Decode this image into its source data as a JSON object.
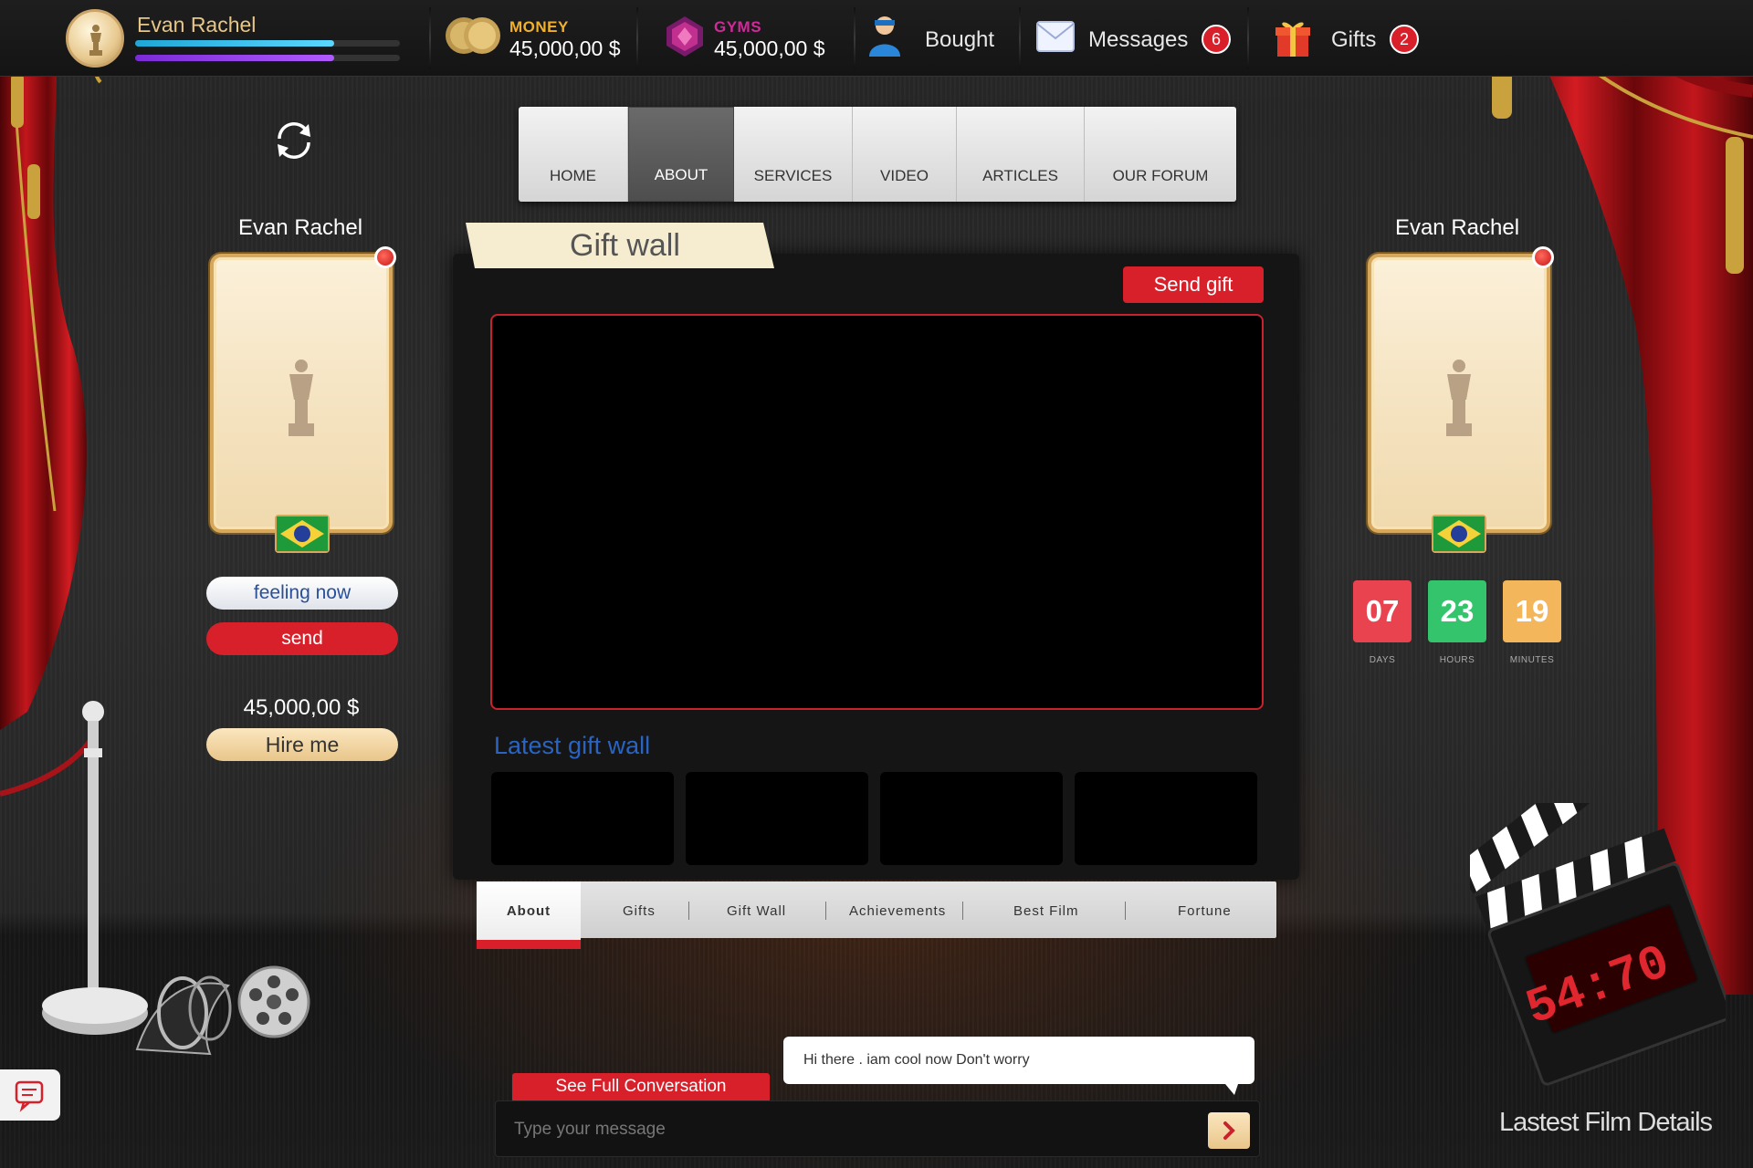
{
  "header": {
    "user_name": "Evan Rachel",
    "money_label": "MONEY",
    "money_value": "45,000,00 $",
    "gyms_label": "GYMS",
    "gyms_value": "45,000,00 $",
    "bought_label": "Bought",
    "messages_label": "Messages",
    "messages_count": "6",
    "gifts_label": "Gifts",
    "gifts_count": "2"
  },
  "nav": {
    "items": [
      "HOME",
      "ABOUT",
      "SERVICES",
      "VIDEO",
      "ARTICLES",
      "OUR FORUM"
    ],
    "active": "ABOUT"
  },
  "left_profile": {
    "name": "Evan Rachel",
    "feeling_label": "feeling now",
    "send_label": "send",
    "amount": "45,000,00 $",
    "hire_label": "Hire me"
  },
  "right_profile": {
    "name": "Evan Rachel",
    "countdown": [
      {
        "value": "07",
        "label": "DAYS",
        "color": "#e9434f"
      },
      {
        "value": "23",
        "label": "HOURS",
        "color": "#33c46c"
      },
      {
        "value": "19",
        "label": "MINUTES",
        "color": "#f3b65a"
      }
    ]
  },
  "gift_wall": {
    "title": "Gift wall",
    "send_gift_label": "Send gift",
    "latest_title": "Latest gift wall"
  },
  "bottom_tabs": [
    "About",
    "Gifts",
    "Gift Wall",
    "Achievements",
    "Best Film",
    "Fortune"
  ],
  "chat": {
    "bubble_text": "Hi there . iam cool now Don't worry",
    "see_full_label": "See Full Conversation",
    "input_placeholder": "Type your message"
  },
  "clapper_display": "54:70",
  "film_details_label": "Lastest Film Details",
  "colors": {
    "accent_red": "#d8202a",
    "gold": "#e7c788",
    "link_blue": "#2a64c0",
    "money_label": "#f0b030",
    "gyms_label": "#d02a9a"
  }
}
